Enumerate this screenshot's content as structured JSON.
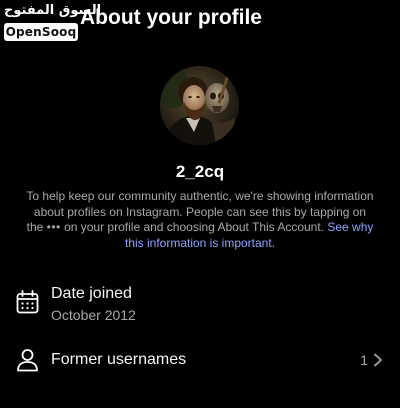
{
  "watermark": {
    "arabic": "السوق المفتوح",
    "latin": "OpenSooq"
  },
  "header": {
    "title": "About your profile"
  },
  "profile": {
    "username": "2_2cq",
    "info_text_before": "To help keep our community authentic, we're showing information about profiles on Instagram. People can see this by tapping on the ",
    "info_dots": "•••",
    "info_text_after": " on your profile and choosing About This Account. ",
    "info_link": "See why this information is important."
  },
  "rows": {
    "date_joined": {
      "icon": "calendar-icon",
      "title": "Date joined",
      "value": "October 2012"
    },
    "former_usernames": {
      "icon": "person-icon",
      "title": "Former usernames",
      "count": "1",
      "chevron": "chevron-right-icon"
    }
  },
  "colors": {
    "background": "#000000",
    "primary_text": "#ffffff",
    "secondary_text": "#a8a8a8",
    "link": "#8ea4ff"
  }
}
